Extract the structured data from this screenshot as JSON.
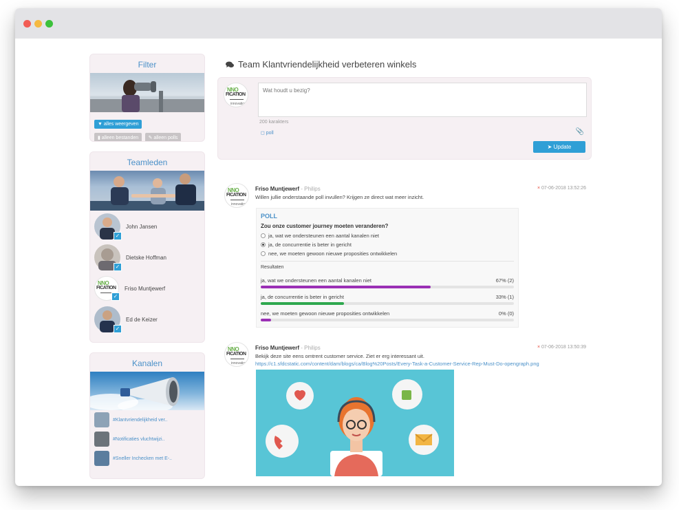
{
  "window": {
    "controls": [
      "close",
      "minimize",
      "zoom"
    ]
  },
  "sidebar": {
    "filter": {
      "title": "Filter",
      "buttons": {
        "all": "alles weergeven",
        "files": "alleen bestanden",
        "polls": "alleen polls"
      }
    },
    "team": {
      "title": "Teamleden",
      "members": [
        {
          "name": "John Jansen"
        },
        {
          "name": "Dietske Hoffman"
        },
        {
          "name": "Friso Muntjewerf"
        },
        {
          "name": "Ed de Keizer"
        }
      ]
    },
    "channels": {
      "title": "Kanalen",
      "items": [
        {
          "label": "#Klantvriendelijkheid ver.."
        },
        {
          "label": "#Notificaties vluchtwijzi.."
        },
        {
          "label": "#Sneller Inchecken met E-.."
        }
      ]
    }
  },
  "main": {
    "title": "Team Klantvriendelijkheid verbeteren winkels",
    "compose": {
      "placeholder": "Wat houdt u bezig?",
      "char_count": "200 karakters",
      "poll_label": "poll",
      "update_label": "Update"
    },
    "logo": {
      "line1": "NNO",
      "line2": "FICATION",
      "line3": "innovation"
    },
    "posts": [
      {
        "author": "Friso Muntjewerf",
        "org": " - Philips",
        "time": "07-06-2018 13:52:26",
        "text": "Willen jullie onderstaande poll invullen? Krijgen ze direct wat meer inzicht.",
        "poll": {
          "heading": "POLL",
          "question": "Zou onze customer journey moeten veranderen?",
          "options": [
            {
              "label": "ja, wat we ondersteunen een aantal kanalen niet",
              "selected": false
            },
            {
              "label": "ja, de concurrentie is beter in gericht",
              "selected": true
            },
            {
              "label": "nee, we moeten gewoon nieuwe proposities ontwikkelen",
              "selected": false
            }
          ],
          "results_label": "Resultaten",
          "results": [
            {
              "label": "ja, wat we ondersteunen een aantal kanalen niet",
              "value_text": "67% (2)",
              "percent": 67,
              "color": "#9b30b5"
            },
            {
              "label": "ja, de concurrentie is beter in gericht",
              "value_text": "33% (1)",
              "percent": 33,
              "color": "#2fa84f"
            },
            {
              "label": "nee, we moeten gewoon nieuwe proposities ontwikkelen",
              "value_text": "0% (0)",
              "percent": 0,
              "color": "#9b30b5"
            }
          ]
        }
      },
      {
        "author": "Friso Muntjewerf",
        "org": " - Philips",
        "time": "07-06-2018 13:50:39",
        "text": "Bekijk deze site eens omtrent customer service. Ziet er erg interessant uit.",
        "link": "https://c1.sfdcstatic.com/content/dam/blogs/ca/Blog%20Posts/Every-Task-a-Customer-Service-Rep-Must-Do-opengraph.png"
      }
    ]
  },
  "colors": {
    "accent": "#2f9fd6",
    "link": "#4a90c8",
    "panel_bg": "#f6f0f3"
  }
}
